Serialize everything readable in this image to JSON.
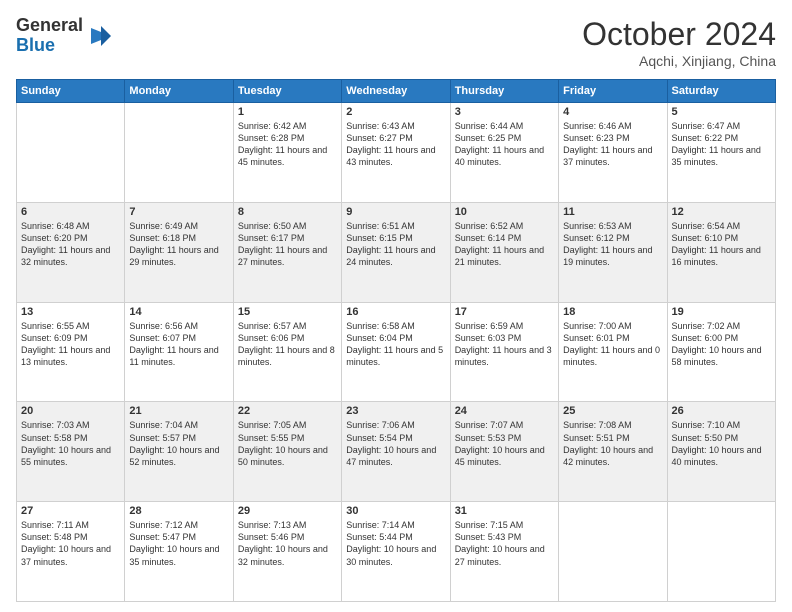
{
  "header": {
    "logo_general": "General",
    "logo_blue": "Blue",
    "title": "October 2024",
    "location": "Aqchi, Xinjiang, China"
  },
  "weekdays": [
    "Sunday",
    "Monday",
    "Tuesday",
    "Wednesday",
    "Thursday",
    "Friday",
    "Saturday"
  ],
  "weeks": [
    [
      {
        "day": "",
        "info": ""
      },
      {
        "day": "",
        "info": ""
      },
      {
        "day": "1",
        "info": "Sunrise: 6:42 AM\nSunset: 6:28 PM\nDaylight: 11 hours and 45 minutes."
      },
      {
        "day": "2",
        "info": "Sunrise: 6:43 AM\nSunset: 6:27 PM\nDaylight: 11 hours and 43 minutes."
      },
      {
        "day": "3",
        "info": "Sunrise: 6:44 AM\nSunset: 6:25 PM\nDaylight: 11 hours and 40 minutes."
      },
      {
        "day": "4",
        "info": "Sunrise: 6:46 AM\nSunset: 6:23 PM\nDaylight: 11 hours and 37 minutes."
      },
      {
        "day": "5",
        "info": "Sunrise: 6:47 AM\nSunset: 6:22 PM\nDaylight: 11 hours and 35 minutes."
      }
    ],
    [
      {
        "day": "6",
        "info": "Sunrise: 6:48 AM\nSunset: 6:20 PM\nDaylight: 11 hours and 32 minutes."
      },
      {
        "day": "7",
        "info": "Sunrise: 6:49 AM\nSunset: 6:18 PM\nDaylight: 11 hours and 29 minutes."
      },
      {
        "day": "8",
        "info": "Sunrise: 6:50 AM\nSunset: 6:17 PM\nDaylight: 11 hours and 27 minutes."
      },
      {
        "day": "9",
        "info": "Sunrise: 6:51 AM\nSunset: 6:15 PM\nDaylight: 11 hours and 24 minutes."
      },
      {
        "day": "10",
        "info": "Sunrise: 6:52 AM\nSunset: 6:14 PM\nDaylight: 11 hours and 21 minutes."
      },
      {
        "day": "11",
        "info": "Sunrise: 6:53 AM\nSunset: 6:12 PM\nDaylight: 11 hours and 19 minutes."
      },
      {
        "day": "12",
        "info": "Sunrise: 6:54 AM\nSunset: 6:10 PM\nDaylight: 11 hours and 16 minutes."
      }
    ],
    [
      {
        "day": "13",
        "info": "Sunrise: 6:55 AM\nSunset: 6:09 PM\nDaylight: 11 hours and 13 minutes."
      },
      {
        "day": "14",
        "info": "Sunrise: 6:56 AM\nSunset: 6:07 PM\nDaylight: 11 hours and 11 minutes."
      },
      {
        "day": "15",
        "info": "Sunrise: 6:57 AM\nSunset: 6:06 PM\nDaylight: 11 hours and 8 minutes."
      },
      {
        "day": "16",
        "info": "Sunrise: 6:58 AM\nSunset: 6:04 PM\nDaylight: 11 hours and 5 minutes."
      },
      {
        "day": "17",
        "info": "Sunrise: 6:59 AM\nSunset: 6:03 PM\nDaylight: 11 hours and 3 minutes."
      },
      {
        "day": "18",
        "info": "Sunrise: 7:00 AM\nSunset: 6:01 PM\nDaylight: 11 hours and 0 minutes."
      },
      {
        "day": "19",
        "info": "Sunrise: 7:02 AM\nSunset: 6:00 PM\nDaylight: 10 hours and 58 minutes."
      }
    ],
    [
      {
        "day": "20",
        "info": "Sunrise: 7:03 AM\nSunset: 5:58 PM\nDaylight: 10 hours and 55 minutes."
      },
      {
        "day": "21",
        "info": "Sunrise: 7:04 AM\nSunset: 5:57 PM\nDaylight: 10 hours and 52 minutes."
      },
      {
        "day": "22",
        "info": "Sunrise: 7:05 AM\nSunset: 5:55 PM\nDaylight: 10 hours and 50 minutes."
      },
      {
        "day": "23",
        "info": "Sunrise: 7:06 AM\nSunset: 5:54 PM\nDaylight: 10 hours and 47 minutes."
      },
      {
        "day": "24",
        "info": "Sunrise: 7:07 AM\nSunset: 5:53 PM\nDaylight: 10 hours and 45 minutes."
      },
      {
        "day": "25",
        "info": "Sunrise: 7:08 AM\nSunset: 5:51 PM\nDaylight: 10 hours and 42 minutes."
      },
      {
        "day": "26",
        "info": "Sunrise: 7:10 AM\nSunset: 5:50 PM\nDaylight: 10 hours and 40 minutes."
      }
    ],
    [
      {
        "day": "27",
        "info": "Sunrise: 7:11 AM\nSunset: 5:48 PM\nDaylight: 10 hours and 37 minutes."
      },
      {
        "day": "28",
        "info": "Sunrise: 7:12 AM\nSunset: 5:47 PM\nDaylight: 10 hours and 35 minutes."
      },
      {
        "day": "29",
        "info": "Sunrise: 7:13 AM\nSunset: 5:46 PM\nDaylight: 10 hours and 32 minutes."
      },
      {
        "day": "30",
        "info": "Sunrise: 7:14 AM\nSunset: 5:44 PM\nDaylight: 10 hours and 30 minutes."
      },
      {
        "day": "31",
        "info": "Sunrise: 7:15 AM\nSunset: 5:43 PM\nDaylight: 10 hours and 27 minutes."
      },
      {
        "day": "",
        "info": ""
      },
      {
        "day": "",
        "info": ""
      }
    ]
  ]
}
